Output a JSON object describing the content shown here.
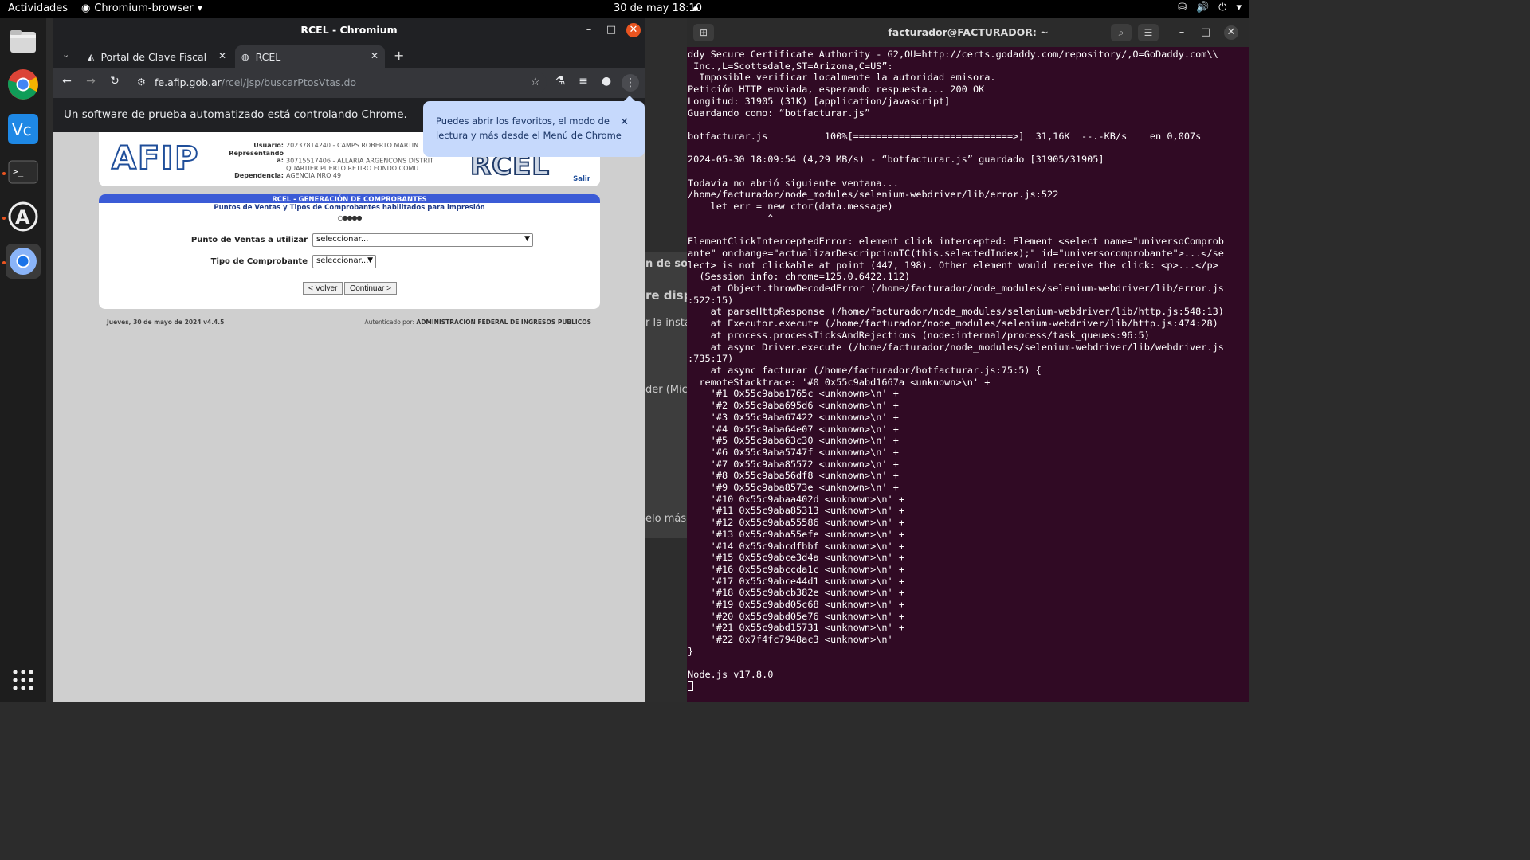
{
  "topbar": {
    "activities": "Actividades",
    "app": "Chromium-browser",
    "clock": "30 de may  18:10"
  },
  "dock": {
    "items": [
      "files-icon",
      "chrome-icon",
      "vscode-icon",
      "terminal-icon",
      "software-icon",
      "chromium-icon",
      "app-grid-icon"
    ]
  },
  "desktop_bg": {
    "fragments": [
      "n de soft",
      "re disp",
      "r la instal",
      "der (Micr",
      "elo más ta"
    ]
  },
  "chrome": {
    "window_title": "RCEL - Chromium",
    "tabs": [
      {
        "label": "Portal de Clave Fiscal"
      },
      {
        "label": "RCEL"
      }
    ],
    "url_host": "fe.afip.gob.ar",
    "url_path": "/rcel/jsp/buscarPtosVtas.do",
    "infobar": "Un software de prueba automatizado está controlando Chrome.",
    "popup": {
      "line1": "Puedes abrir los favoritos, el modo de",
      "line2": "lectura y más desde el Menú de Chrome"
    }
  },
  "afip": {
    "logo": "AFIP",
    "rcel_logo": "RCEL",
    "usuario_label": "Usuario:",
    "usuario": "20237814240 - CAMPS ROBERTO MARTIN",
    "representando_label": "Representando a:",
    "representando_1": "30715517406 - ALLARIA ARGENCONS DISTRIT",
    "representando_2": "QUARTIER PUERTO RETIRO FONDO COMU",
    "dependencia_label": "Dependencia:",
    "dependencia": "AGENCIA NRO 49",
    "salir": "Salir",
    "form_title": "RCEL - GENERACIÓN DE COMPROBANTES",
    "form_subtitle": "Puntos de Ventas y Tipos de Comprobantes habilitados para impresión",
    "steps": "○●●●●",
    "punto_label": "Punto de Ventas a utilizar",
    "punto_value": "seleccionar...",
    "tipo_label": "Tipo de Comprobante",
    "tipo_value": "seleccionar...",
    "volver": "< Volver",
    "continuar": "Continuar >",
    "footer_date": "Jueves, 30 de mayo de 2024 v4.4.5",
    "footer_auth_label": "Autenticado por:",
    "footer_auth": "ADMINISTRACION FEDERAL DE INGRESOS PUBLICOS"
  },
  "terminal": {
    "title": "facturador@FACTURADOR: ~",
    "lines": [
      "ddy Secure Certificate Authority - G2,OU=http://certs.godaddy.com/repository/,O=GoDaddy.com\\\\",
      " Inc.,L=Scottsdale,ST=Arizona,C=US”:",
      "  Imposible verificar localmente la autoridad emisora.",
      "Petición HTTP enviada, esperando respuesta... 200 OK",
      "Longitud: 31905 (31K) [application/javascript]",
      "Guardando como: “botfacturar.js”",
      "",
      "botfacturar.js          100%[============================>]  31,16K  --.-KB/s    en 0,007s",
      "",
      "2024-05-30 18:09:54 (4,29 MB/s) - “botfacturar.js” guardado [31905/31905]",
      "",
      "Todavia no abrió siguiente ventana...",
      "/home/facturador/node_modules/selenium-webdriver/lib/error.js:522",
      "    let err = new ctor(data.message)",
      "              ^",
      "",
      "ElementClickInterceptedError: element click intercepted: Element <select name=\"universoComprob",
      "ante\" onchange=\"actualizarDescripcionTC(this.selectedIndex);\" id=\"universocomprobante\">...</se",
      "lect> is not clickable at point (447, 198). Other element would receive the click: <p>...</p>",
      "  (Session info: chrome=125.0.6422.112)",
      "    at Object.throwDecodedError (/home/facturador/node_modules/selenium-webdriver/lib/error.js",
      ":522:15)",
      "    at parseHttpResponse (/home/facturador/node_modules/selenium-webdriver/lib/http.js:548:13)",
      "    at Executor.execute (/home/facturador/node_modules/selenium-webdriver/lib/http.js:474:28)",
      "    at process.processTicksAndRejections (node:internal/process/task_queues:96:5)",
      "    at async Driver.execute (/home/facturador/node_modules/selenium-webdriver/lib/webdriver.js",
      ":735:17)",
      "    at async facturar (/home/facturador/botfacturar.js:75:5) {",
      "  remoteStacktrace: '#0 0x55c9abd1667a <unknown>\\n' +",
      "    '#1 0x55c9aba1765c <unknown>\\n' +",
      "    '#2 0x55c9aba695d6 <unknown>\\n' +",
      "    '#3 0x55c9aba67422 <unknown>\\n' +",
      "    '#4 0x55c9aba64e07 <unknown>\\n' +",
      "    '#5 0x55c9aba63c30 <unknown>\\n' +",
      "    '#6 0x55c9aba5747f <unknown>\\n' +",
      "    '#7 0x55c9aba85572 <unknown>\\n' +",
      "    '#8 0x55c9aba56df8 <unknown>\\n' +",
      "    '#9 0x55c9aba8573e <unknown>\\n' +",
      "    '#10 0x55c9abaa402d <unknown>\\n' +",
      "    '#11 0x55c9aba85313 <unknown>\\n' +",
      "    '#12 0x55c9aba55586 <unknown>\\n' +",
      "    '#13 0x55c9aba55efe <unknown>\\n' +",
      "    '#14 0x55c9abcdfbbf <unknown>\\n' +",
      "    '#15 0x55c9abce3d4a <unknown>\\n' +",
      "    '#16 0x55c9abccda1c <unknown>\\n' +",
      "    '#17 0x55c9abce44d1 <unknown>\\n' +",
      "    '#18 0x55c9abcb382e <unknown>\\n' +",
      "    '#19 0x55c9abd05c68 <unknown>\\n' +",
      "    '#20 0x55c9abd05e76 <unknown>\\n' +",
      "    '#21 0x55c9abd15731 <unknown>\\n' +",
      "    '#22 0x7f4fc7948ac3 <unknown>\\n'",
      "}",
      "",
      "Node.js v17.8.0"
    ]
  }
}
